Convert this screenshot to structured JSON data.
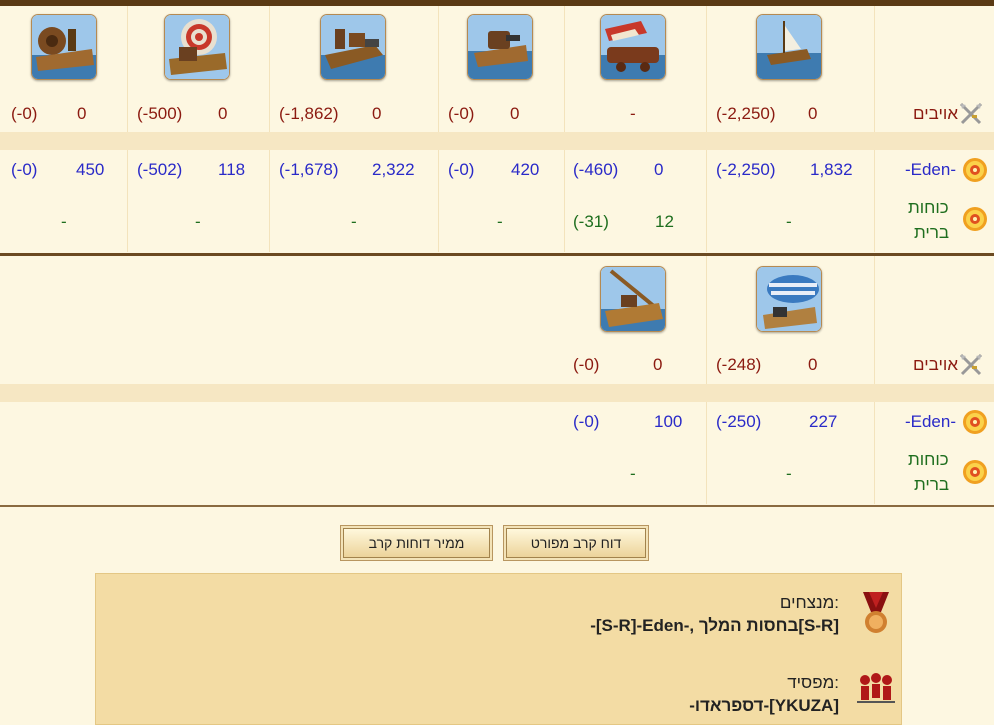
{
  "top_table": {
    "rows": {
      "enemy_label": "אויבים",
      "own_label": "-Eden-",
      "land_label_line1": "כוחות",
      "land_label_line2": "ברית"
    },
    "units": [
      {
        "icon": "ship-icon",
        "enemy_val": "0",
        "enemy_loss": "(-2,250)",
        "own_val": "1,832",
        "own_loss": "(-2,250)",
        "land_val": "-",
        "land_loss": ""
      },
      {
        "icon": "catapult-icon",
        "enemy_val": "-",
        "enemy_loss": "",
        "own_val": "0",
        "own_loss": "(-460)",
        "land_val": "12",
        "land_loss": "(-31)"
      },
      {
        "icon": "cannon-ship-icon",
        "enemy_val": "0",
        "enemy_loss": "(-0)",
        "own_val": "420",
        "own_loss": "(-0)",
        "land_val": "-",
        "land_loss": ""
      },
      {
        "icon": "steam-ram-icon",
        "enemy_val": "0",
        "enemy_loss": "(-1,862)",
        "own_val": "2,322",
        "own_loss": "(-1,678)",
        "land_val": "-",
        "land_loss": ""
      },
      {
        "icon": "mortar-ship-icon",
        "enemy_val": "0",
        "enemy_loss": "(-500)",
        "own_val": "118",
        "own_loss": "(-502)",
        "land_val": "-",
        "land_loss": ""
      },
      {
        "icon": "paddle-wheel-icon",
        "enemy_val": "0",
        "enemy_loss": "(-0)",
        "own_val": "450",
        "own_loss": "(-0)",
        "land_val": "-",
        "land_loss": ""
      }
    ]
  },
  "bottom_table": {
    "rows": {
      "enemy_label": "אויבים",
      "own_label": "-Eden-",
      "land_label_line1": "כוחות",
      "land_label_line2": "ברית"
    },
    "units": [
      {
        "icon": "balloon-carrier-icon",
        "enemy_val": "0",
        "enemy_loss": "(-248)",
        "own_val": "227",
        "own_loss": "(-250)",
        "land_val": "-",
        "land_loss": ""
      },
      {
        "icon": "tender-icon",
        "enemy_val": "0",
        "enemy_loss": "(-0)",
        "own_val": "100",
        "own_loss": "(-0)",
        "land_val": "-",
        "land_loss": ""
      }
    ]
  },
  "buttons": {
    "detailed_report": "דוח קרב מפורט",
    "converter": "ממיר דוחות קרב"
  },
  "result": {
    "winners_title": "מנצחים:",
    "winners_value": "-[S-R]-Eden-, בחסות המלך[S-R]",
    "loser_title": "מפסיד:",
    "loser_value": "-דספראדו-[YKUZA]"
  },
  "colors": {
    "enemy": "#8b1a10",
    "own": "#2a2ac8",
    "allied": "#1e6e1e",
    "background": "#fdf7e1",
    "band": "#f6e7c3"
  }
}
